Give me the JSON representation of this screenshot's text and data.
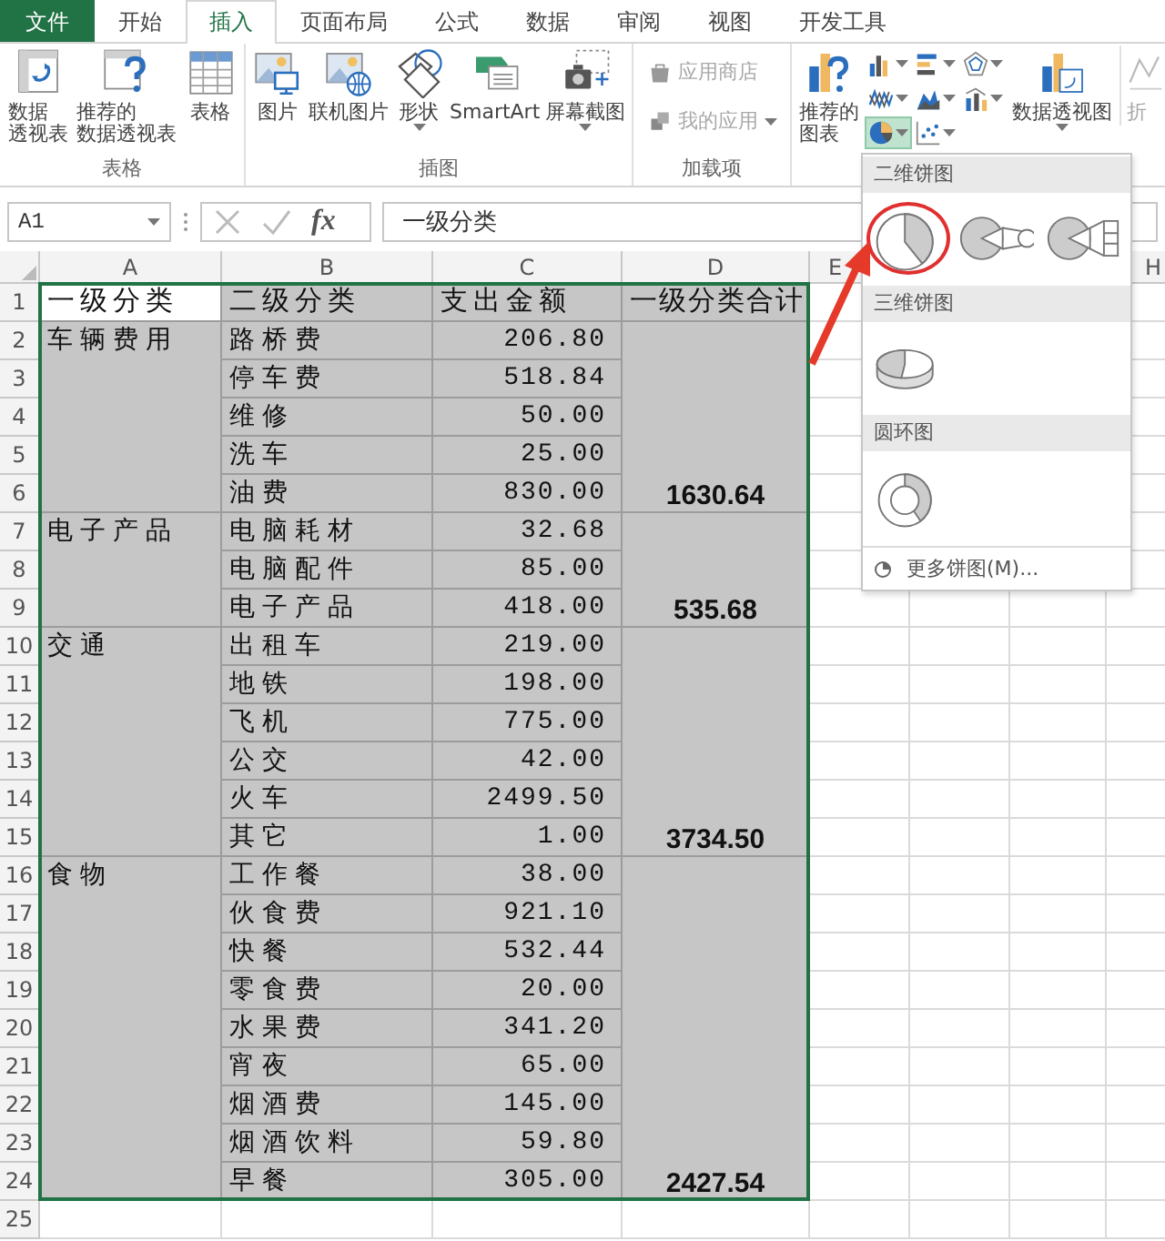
{
  "tabs": [
    {
      "label": "文件",
      "kind": "file",
      "selected": false
    },
    {
      "label": "开始",
      "kind": "tab",
      "selected": false
    },
    {
      "label": "插入",
      "kind": "tab",
      "selected": true
    },
    {
      "label": "页面布局",
      "kind": "tab",
      "selected": false
    },
    {
      "label": "公式",
      "kind": "tab",
      "selected": false
    },
    {
      "label": "数据",
      "kind": "tab",
      "selected": false
    },
    {
      "label": "审阅",
      "kind": "tab",
      "selected": false
    },
    {
      "label": "视图",
      "kind": "tab",
      "selected": false
    },
    {
      "label": "开发工具",
      "kind": "tab",
      "selected": false
    }
  ],
  "ribbon": {
    "groups": [
      {
        "label": "表格",
        "kind": "large",
        "items": [
          {
            "kind": "pivot-table",
            "lines": [
              "数据",
              "透视表"
            ]
          },
          {
            "kind": "recommended-pivot",
            "lines": [
              "推荐的",
              "数据透视表"
            ]
          },
          {
            "kind": "table",
            "lines": [
              "表格"
            ]
          }
        ]
      },
      {
        "label": "插图",
        "kind": "large",
        "items": [
          {
            "kind": "picture",
            "lines": [
              "图片"
            ]
          },
          {
            "kind": "online-picture",
            "lines": [
              "联机图片"
            ]
          },
          {
            "kind": "shapes",
            "lines": [
              "形状"
            ],
            "has_menu": true
          },
          {
            "kind": "smartart",
            "lines": [
              "SmartArt"
            ]
          },
          {
            "kind": "screenshot",
            "lines": [
              "屏幕截图"
            ],
            "has_menu": true
          }
        ]
      },
      {
        "label": "加载项",
        "kind": "small",
        "items": [
          {
            "kind": "store",
            "lines": [
              "应用商店"
            ],
            "disabled": true
          },
          {
            "kind": "my-apps",
            "lines": [
              "我的应用"
            ],
            "disabled": true,
            "has_menu": true
          }
        ]
      },
      {
        "kind": "charts",
        "items": [
          {
            "kind": "recommended-chart",
            "lines": [
              "推荐的",
              "图表"
            ]
          },
          {
            "kind": "column-chart",
            "has_menu": true,
            "pressed": false
          },
          {
            "kind": "bar-chart",
            "has_menu": true,
            "pressed": false
          },
          {
            "kind": "radar-chart",
            "has_menu": true,
            "pressed": false
          },
          {
            "kind": "line-chart",
            "has_menu": true,
            "pressed": false
          },
          {
            "kind": "area-chart",
            "has_menu": true,
            "pressed": false
          },
          {
            "kind": "combo-chart",
            "has_menu": true,
            "pressed": false
          },
          {
            "kind": "pie-chart",
            "has_menu": true,
            "pressed": true
          },
          {
            "kind": "scatter-chart",
            "has_menu": true,
            "pressed": false
          },
          {
            "kind": "pivot-chart",
            "lines": [
              "数据透视图"
            ],
            "has_menu": true
          },
          {
            "kind": "sparkline",
            "lines": [
              "折"
            ],
            "disabled": true
          }
        ]
      }
    ]
  },
  "formula_bar": {
    "name_box": "A1",
    "function_button": "fx",
    "formula": "一级分类"
  },
  "sheet": {
    "columns": [
      {
        "label": "A"
      },
      {
        "label": "B"
      },
      {
        "label": "C"
      },
      {
        "label": "D"
      },
      {
        "label": "E"
      },
      {},
      {},
      {
        "label": "H"
      }
    ],
    "row_numbers": [
      "1",
      "2",
      "3",
      "4",
      "5",
      "6",
      "7",
      "8",
      "9",
      "10",
      "11",
      "12",
      "13",
      "14",
      "15",
      "16",
      "17",
      "18",
      "19",
      "20",
      "21",
      "22",
      "23",
      "24",
      "25"
    ],
    "header": [
      {
        "text": "一级分类",
        "active": true
      },
      {
        "text": "二级分类",
        "active": false
      },
      {
        "text": "支出金额",
        "active": false
      },
      {
        "text": "一级分类合计",
        "active": false
      }
    ],
    "groups": [
      {
        "category": "车辆费用",
        "total": "1630.64",
        "items": [
          {
            "name": "路桥费",
            "amount": "206.80"
          },
          {
            "name": "停车费",
            "amount": "518.84"
          },
          {
            "name": "维修",
            "amount": "50.00"
          },
          {
            "name": "洗车",
            "amount": "25.00"
          },
          {
            "name": "油费",
            "amount": "830.00"
          }
        ]
      },
      {
        "category": "电子产品",
        "total": "535.68",
        "items": [
          {
            "name": "电脑耗材",
            "amount": "32.68"
          },
          {
            "name": "电脑配件",
            "amount": "85.00"
          },
          {
            "name": "电子产品",
            "amount": "418.00"
          }
        ]
      },
      {
        "category": "交通",
        "total": "3734.50",
        "items": [
          {
            "name": "出租车",
            "amount": "219.00"
          },
          {
            "name": "地铁",
            "amount": "198.00"
          },
          {
            "name": "飞机",
            "amount": "775.00"
          },
          {
            "name": "公交",
            "amount": "42.00"
          },
          {
            "name": "火车",
            "amount": "2499.50"
          },
          {
            "name": "其它",
            "amount": "1.00"
          }
        ]
      },
      {
        "category": "食物",
        "total": "2427.54",
        "items": [
          {
            "name": "工作餐",
            "amount": "38.00"
          },
          {
            "name": "伙食费",
            "amount": "921.10"
          },
          {
            "name": "快餐",
            "amount": "532.44"
          },
          {
            "name": "零食费",
            "amount": "20.00"
          },
          {
            "name": "水果费",
            "amount": "341.20"
          },
          {
            "name": "宵夜",
            "amount": "65.00"
          },
          {
            "name": "烟酒费",
            "amount": "145.00"
          },
          {
            "name": "烟酒饮料",
            "amount": "59.80"
          },
          {
            "name": "早餐",
            "amount": "305.00"
          }
        ]
      }
    ]
  },
  "chart_menu": {
    "sections": [
      {
        "title": "二维饼图",
        "charts": [
          {
            "kind": "pie",
            "highlighted": true
          },
          {
            "kind": "pie-of-pie",
            "highlighted": false
          },
          {
            "kind": "bar-of-pie",
            "highlighted": false
          }
        ]
      },
      {
        "title": "三维饼图",
        "charts": [
          {
            "kind": "pie-3d",
            "highlighted": false
          }
        ]
      },
      {
        "title": "圆环图",
        "charts": [
          {
            "kind": "donut",
            "highlighted": false
          }
        ]
      }
    ],
    "more": "更多饼图(M)..."
  }
}
